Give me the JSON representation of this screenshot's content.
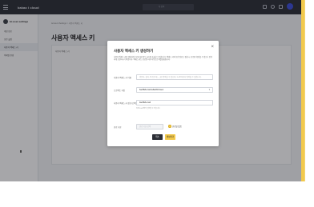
{
  "app": {
    "title": "kakao i cloud",
    "search_placeholder": "Q 검색"
  },
  "sidebar": {
    "account_name": "kc-user-settings",
    "items": [
      {
        "label": "계정 정보"
      },
      {
        "label": "보안 설정"
      },
      {
        "label": "사용자 액세스 키"
      },
      {
        "label": "이메일 변경"
      }
    ]
  },
  "breadcrumb": "Account Settings > 사용자 액세스 키",
  "page_title": "사용자 액세스 키",
  "main_panel_label": "사용자 액세스 키",
  "modal": {
    "title": "사용자 액세스 키 생성하기",
    "close": "×",
    "description": "사용자 액세스 키를 생성하여 카카오클라우드 API를 호출할 수 있습니다. 액세스 키의 보안 정보는 생성 시 한 번만 확인할 수 있으니 안전하게 보관하시기 바랍니다. 액세스 키는 만료일 이후 자동으로 비활성화됩니다.",
    "fields": [
      {
        "label": "사용자 액세스 키 이름",
        "value": "",
        "placeholder": "영문자, 숫자, 특수문자(-, _)만 입력할 수 있으며, 1~20자까지 입력할 수 있습니다."
      },
      {
        "label": "프로젝트 지정",
        "value": "6ac882fe-ba6-fe8ac8b3-bae1"
      },
      {
        "label": "사용자 액세스 키 정보 (선택)",
        "value": "9ac882fe-ba6",
        "hint": "최대 100자까지 입력할 수 있습니다."
      },
      {
        "label": "만료 기한",
        "value": "",
        "placeholder": "만료 기한 선택"
      }
    ],
    "never_expire_label": "만료일 없음",
    "cancel_label": "취소",
    "confirm_label": "생성하기"
  },
  "colors": {
    "accent": "#f2c94c",
    "topbar": "#2b2e35",
    "overlay": "rgba(20,22,28,0.38)"
  }
}
